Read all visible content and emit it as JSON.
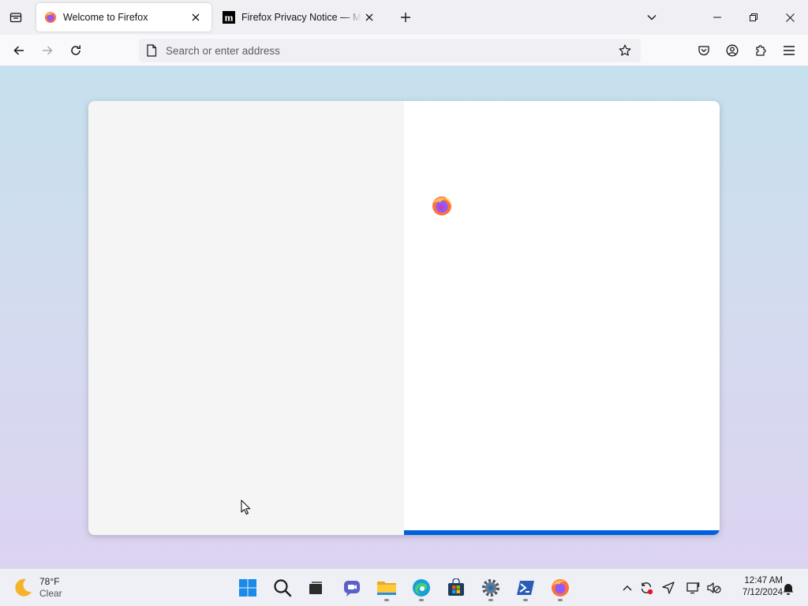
{
  "browser": {
    "tabs": [
      {
        "title": "Welcome to Firefox",
        "icon": "firefox-icon",
        "active": true
      },
      {
        "title": "Firefox Privacy Notice — Mozilla",
        "icon": "mozilla-m-icon",
        "active": false
      }
    ],
    "urlbar": {
      "placeholder": "Search or enter address",
      "value": ""
    },
    "accent_color": "#0060df"
  },
  "onboarding": {
    "logo": "firefox-icon",
    "progress_fraction": 1.0
  },
  "taskbar": {
    "weather": {
      "temperature": "78°F",
      "condition": "Clear",
      "icon": "moon-icon"
    },
    "apps": [
      "start",
      "search",
      "task-view",
      "chat",
      "file-explorer",
      "edge",
      "store",
      "settings",
      "powershell",
      "firefox"
    ],
    "clock": {
      "time": "12:47 AM",
      "date": "7/12/2024"
    }
  }
}
